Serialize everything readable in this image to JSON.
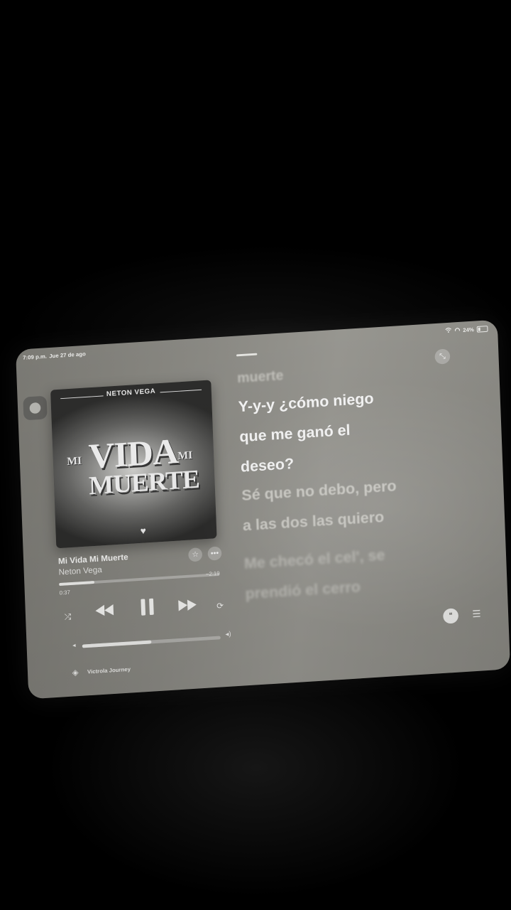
{
  "status_bar": {
    "time": "7:09 p.m.",
    "date": "Jue 27 de ago",
    "battery": "24%"
  },
  "album": {
    "artist_art": "NETON VEGA",
    "title_mi_left": "MI",
    "title_vida": "VIDA",
    "title_mi_right": "MI",
    "title_muerte": "MUERTE"
  },
  "track": {
    "title": "Mi Vida Mi Muerte",
    "artist": "Neton Vega",
    "elapsed": "0:37",
    "remaining": "−2:19",
    "progress_fraction": 0.22
  },
  "volume": {
    "level_fraction": 0.5
  },
  "output_device": "Victrola Journey",
  "lyrics": {
    "previous": "muerte",
    "active": [
      "Y-y-y ¿cómo niego",
      "que me ganó el",
      "deseo?"
    ],
    "next": [
      "Sé que no debo, pero",
      "a las dos las quiero"
    ],
    "next2": [
      "Me checó el cel', se",
      "prendió el cerro"
    ]
  },
  "icons": {
    "star": "star-icon",
    "more": "ellipsis-icon",
    "shuffle": "shuffle-icon",
    "rewind": "rewind-icon",
    "pause": "pause-icon",
    "forward": "fast-forward-icon",
    "repeat": "repeat-icon",
    "airplay": "airplay-icon",
    "lyrics": "quote-bubble-icon",
    "queue": "list-icon",
    "collapse": "collapse-icon"
  }
}
